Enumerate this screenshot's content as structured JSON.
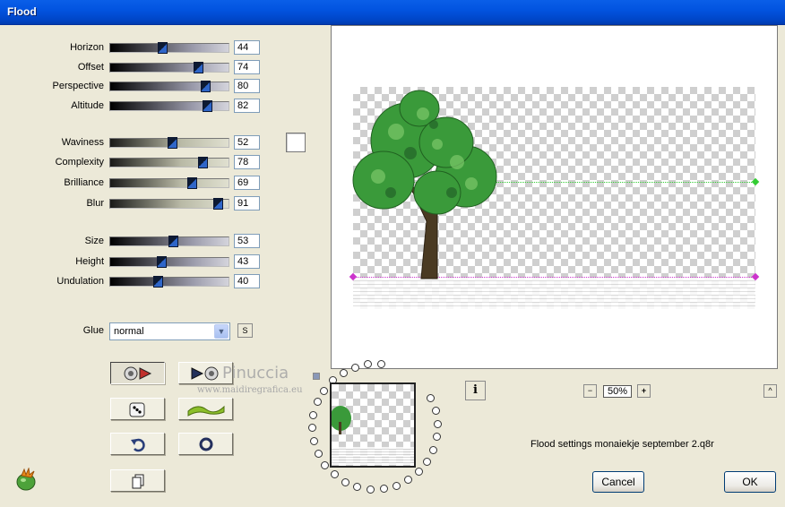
{
  "window": {
    "title": "Flood"
  },
  "params": [
    {
      "id": "horizon",
      "label": "Horizon",
      "value": "44",
      "pct": 0.44,
      "style": "dark"
    },
    {
      "id": "offset",
      "label": "Offset",
      "value": "74",
      "pct": 0.74,
      "style": "dark"
    },
    {
      "id": "perspective",
      "label": "Perspective",
      "value": "80",
      "pct": 0.8,
      "style": "dark"
    },
    {
      "id": "altitude",
      "label": "Altitude",
      "value": "82",
      "pct": 0.82,
      "style": "dark"
    },
    {
      "id": "waviness",
      "label": "Waviness",
      "value": "52",
      "pct": 0.52,
      "style": "light"
    },
    {
      "id": "complexity",
      "label": "Complexity",
      "value": "78",
      "pct": 0.78,
      "style": "light"
    },
    {
      "id": "brilliance",
      "label": "Brilliance",
      "value": "69",
      "pct": 0.69,
      "style": "light"
    },
    {
      "id": "blur",
      "label": "Blur",
      "value": "91",
      "pct": 0.91,
      "style": "light"
    },
    {
      "id": "size",
      "label": "Size",
      "value": "53",
      "pct": 0.53,
      "style": "dark"
    },
    {
      "id": "height",
      "label": "Height",
      "value": "43",
      "pct": 0.43,
      "style": "dark"
    },
    {
      "id": "undulation",
      "label": "Undulation",
      "value": "40",
      "pct": 0.4,
      "style": "dark"
    }
  ],
  "glue": {
    "label": "Glue",
    "value": "normal",
    "s_label": "S"
  },
  "zoom": {
    "value": "50%",
    "minus": "−",
    "plus": "+"
  },
  "info_label": "i",
  "collapse_label": "^",
  "status": "Flood settings monaiekje september 2.q8r",
  "buttons": {
    "cancel": "Cancel",
    "ok": "OK"
  },
  "watermark": {
    "name": "Pinuccia",
    "url": "www.maidiregrafica.eu"
  },
  "colors": {
    "title_bar": "#0254e0",
    "thumb": "#2f66c9",
    "tree": "#3a9a3a",
    "guide_green": "#33cc33",
    "guide_magenta": "#cc33cc"
  }
}
